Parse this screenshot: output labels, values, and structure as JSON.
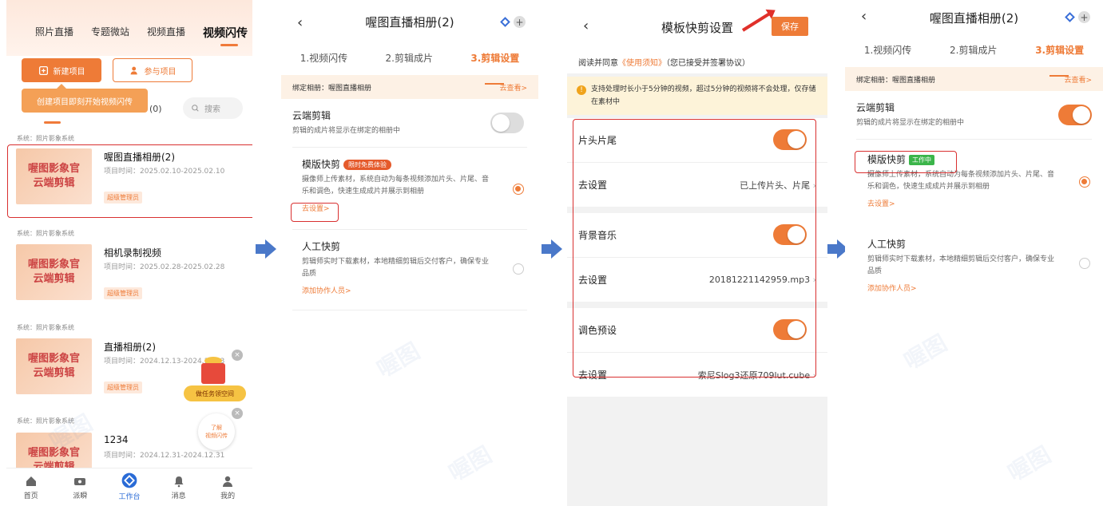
{
  "panel1": {
    "tabs": [
      "照片直播",
      "专题微站",
      "视频直播",
      "视频闪传"
    ],
    "new_project": "新建项目",
    "join_project": "参与项目",
    "tooltip": "创建项目即刻开始视频闪传",
    "count": "(0)",
    "search_placeholder": "搜索",
    "cards": [
      {
        "system": "系统：照片影象系统",
        "thumb_line1": "喔图影象官",
        "thumb_line2": "云端剪辑",
        "title": "喔图直播相册(2)",
        "time": "项目时间：2025.02.10-2025.02.10",
        "badge": "超级管理员"
      },
      {
        "system": "系统：照片影象系统",
        "thumb_line1": "喔图影象官",
        "thumb_line2": "云端剪辑",
        "title": "相机录制视频",
        "time": "项目时间：2025.02.28-2025.02.28",
        "badge": "超级管理员"
      },
      {
        "system": "系统：照片影象系统",
        "thumb_line1": "喔图影象官",
        "thumb_line2": "云端剪辑",
        "title": "直播相册(2)",
        "time": "项目时间：2024.12.13-2024.12.13",
        "badge": "超级管理员"
      },
      {
        "system": "系统：照片影象系统",
        "thumb_line1": "喔图影象官",
        "thumb_line2": "云端剪辑",
        "title": "1234",
        "time": "项目时间：2024.12.31-2024.12.31",
        "badge": ""
      }
    ],
    "gift_label": "做任务领空间",
    "learn_line1": "了解",
    "learn_line2": "视频闪传",
    "nav": [
      "首页",
      "派瞬",
      "工作台",
      "消息",
      "我的"
    ]
  },
  "panel2": {
    "title": "喔图直播相册(2)",
    "tabs": [
      "1.视频闪传",
      "2.剪辑成片",
      "3.剪辑设置"
    ],
    "bind_label": "绑定相册：喔图直播相册",
    "bind_go": "去查看>",
    "cloud_title": "云端剪辑",
    "cloud_desc": "剪辑的成片将显示在绑定的相册中",
    "template_title": "模版快剪",
    "template_pill": "限时免费体验",
    "template_desc": "摄像师上传素材，系统自动为每条视频添加片头、片尾、音乐和调色，快速生成成片并展示到相册",
    "template_link": "去设置>",
    "manual_title": "人工快剪",
    "manual_desc": "剪辑师实时下载素材，本地精细剪辑后交付客户，确保专业品质",
    "manual_link": "添加协作人员>"
  },
  "panel3": {
    "title": "模板快剪设置",
    "save": "保存",
    "agree_prefix": "阅读并同意",
    "agree_link": "《使用须知》",
    "agree_suffix": "（您已接受并签署协议）",
    "notice": "支持处理时长小于5分钟的视频，超过5分钟的视频将不会处理，仅存储在素材中",
    "rows": [
      {
        "label": "片头片尾"
      },
      {
        "label": "去设置",
        "value": "已上传片头、片尾"
      },
      {
        "label": "背景音乐"
      },
      {
        "label": "去设置",
        "value": "20181221142959.mp3"
      },
      {
        "label": "调色预设"
      },
      {
        "label": "去设置",
        "value": "索尼Slog3还原709lut.cube"
      }
    ]
  },
  "panel4": {
    "title": "喔图直播相册(2)",
    "tabs": [
      "1.视频闪传",
      "2.剪辑成片",
      "3.剪辑设置"
    ],
    "bind_label": "绑定相册：喔图直播相册",
    "bind_go": "去查看>",
    "cloud_title": "云端剪辑",
    "cloud_desc": "剪辑的成片将显示在绑定的相册中",
    "template_title": "模版快剪",
    "template_pill": "工作中",
    "template_desc": "摄像师上传素材，系统自动为每条视频添加片头、片尾、音乐和调色，快速生成成片并展示到相册",
    "template_link": "去设置>",
    "manual_title": "人工快剪",
    "manual_desc": "剪辑师实时下载素材，本地精细剪辑后交付客户，确保专业品质",
    "manual_link": "添加协作人员>"
  },
  "watermark": "喔图",
  "colors": {
    "accent": "#ee7b37",
    "highlight_box": "#d93030",
    "arrow": "#4a78c9",
    "nav_active": "#2a6bd6"
  }
}
